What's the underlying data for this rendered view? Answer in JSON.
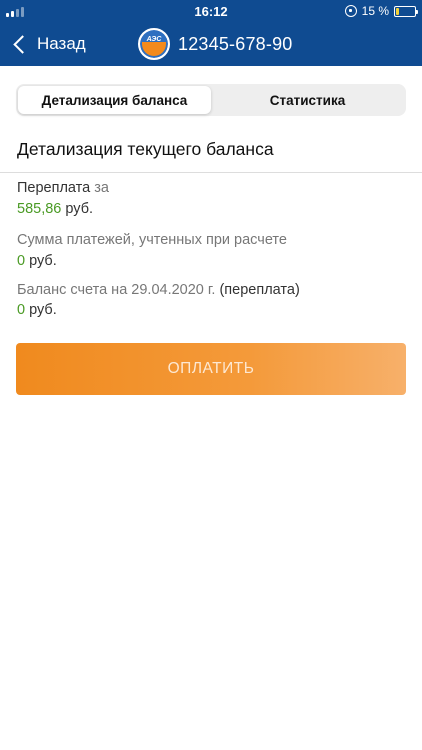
{
  "status_bar": {
    "time": "16:12",
    "battery_percent": "15 %",
    "battery_level": 0.15
  },
  "nav": {
    "back_label": "Назад",
    "logo_text": "АЭС",
    "account_number": "12345-678-90"
  },
  "tabs": [
    {
      "label": "Детализация баланса",
      "active": true
    },
    {
      "label": "Статистика",
      "active": false
    }
  ],
  "section_title": "Детализация текущего баланса",
  "rows": [
    {
      "label": "Переплата",
      "label_suffix": "за",
      "amount": "585,86",
      "unit": "руб."
    },
    {
      "label": "Сумма платежей, учтенных при расчете",
      "label_suffix": "",
      "amount": "0",
      "unit": "руб."
    },
    {
      "label": "Баланс счета на 29.04.2020 г.",
      "label_suffix": "(переплата)",
      "amount": "0",
      "unit": "руб."
    }
  ],
  "pay_button_label": "ОПЛАТИТЬ",
  "colors": {
    "header": "#0f4b91",
    "accent_orange": "#f08a1e",
    "amount_green": "#4a9a24"
  }
}
